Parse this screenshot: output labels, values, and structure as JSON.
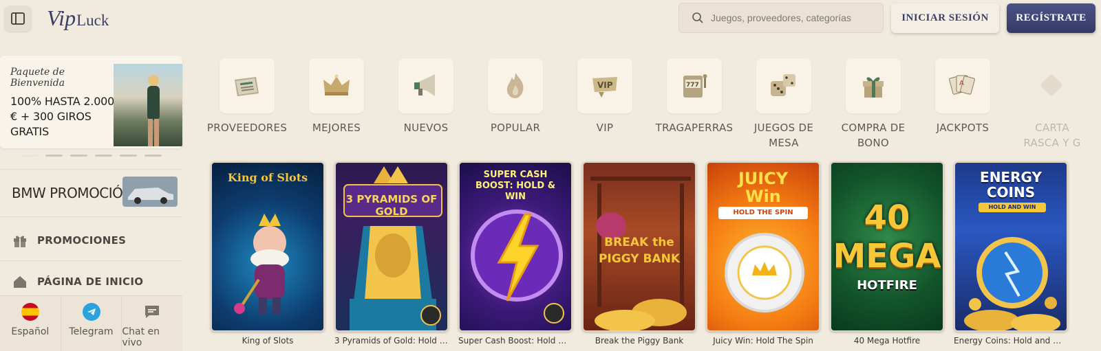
{
  "header": {
    "logo": {
      "vip": "Vip",
      "luck": "Luck"
    },
    "search_placeholder": "Juegos, proveedores, categorías",
    "login_label": "INICIAR SESIÓN",
    "register_label": "REGÍSTRATE"
  },
  "sidebar": {
    "promo": {
      "subtitle": "Paquete de Bienvenida",
      "offer": "100% HASTA 2.000 € + 300 GIROS GRATIS"
    },
    "bmw_label": "BMW PROMOCIÓN",
    "nav": [
      {
        "label": "PROMOCIONES",
        "icon": "gift-icon"
      },
      {
        "label": "PÁGINA DE INICIO",
        "icon": "home-icon"
      }
    ],
    "bottom": [
      {
        "label": "Español",
        "icon": "spain-flag-icon"
      },
      {
        "label": "Telegram",
        "icon": "telegram-icon"
      },
      {
        "label": "Chat en vivo",
        "icon": "chat-icon"
      }
    ]
  },
  "categories": [
    {
      "label": "PROVEEDORES",
      "icon": "newspaper-icon"
    },
    {
      "label": "MEJORES",
      "icon": "crown-icon"
    },
    {
      "label": "NUEVOS",
      "icon": "megaphone-icon"
    },
    {
      "label": "POPULAR",
      "icon": "flame-icon"
    },
    {
      "label": "VIP",
      "icon": "vip-badge-icon"
    },
    {
      "label": "TRAGAPERRAS",
      "icon": "slot-machine-icon"
    },
    {
      "label": "JUEGOS DE MESA",
      "icon": "dice-icon"
    },
    {
      "label": "COMPRA DE BONO",
      "icon": "gift-box-icon"
    },
    {
      "label": "JACKPOTS",
      "icon": "cards-icon"
    },
    {
      "label": "CARTA RASCA Y G",
      "icon": "scratch-icon"
    }
  ],
  "games": [
    {
      "title": "King of Slots",
      "art": "King of Slots"
    },
    {
      "title": "3 Pyramids of Gold: Hold & ...",
      "art": "3 PYRAMIDS OF GOLD"
    },
    {
      "title": "Super Cash Boost: Hold & Win",
      "art": "SUPER CASH BOOST: HOLD & WIN"
    },
    {
      "title": "Break the Piggy Bank",
      "art": "BREAK the PIGGY BANK"
    },
    {
      "title": "Juicy Win: Hold The Spin",
      "art": "JUICY Win"
    },
    {
      "title": "40 Mega Hotfire",
      "art": "40 MEGA"
    },
    {
      "title": "Energy Coins: Hold and Win",
      "art": "ENERGY COINS"
    }
  ],
  "colors": {
    "background": "#f1ebdf",
    "brand": "#3b3f63",
    "register": "#414878"
  }
}
